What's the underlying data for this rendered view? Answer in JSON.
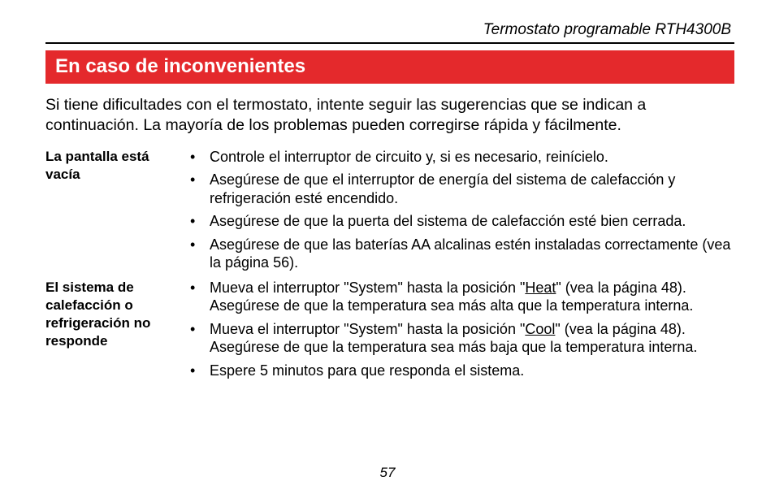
{
  "header": {
    "title": "Termostato programable RTH4300B"
  },
  "banner": {
    "title": "En caso de inconvenientes"
  },
  "intro": {
    "text": "Si tiene dificultades con el termostato, intente seguir las sugerencias que se indican a continuación. La mayoría de los problemas pueden corregirse rápida y fácilmente."
  },
  "sections": [
    {
      "label": "La pantalla está vacía",
      "items": [
        {
          "text": "Controle el interruptor de circuito y, si es necesario, reinícielo."
        },
        {
          "text": "Asegúrese de que el interruptor de energía del sistema de calefacción y refrigeración esté encendido."
        },
        {
          "text": "Asegúrese de que la puerta del sistema de calefacción esté bien cerrada."
        },
        {
          "text": "Asegúrese de que las baterías AA alcalinas estén instaladas correctamente (vea la página 56)."
        }
      ]
    },
    {
      "label": "El sistema de calefacción o refrigeración no responde",
      "items": [
        {
          "pre": "Mueva el interruptor \"System\" hasta la posición \"",
          "u": "Heat",
          "post": "\" (vea la página 48). Asegúrese de que la temperatura sea más alta que la temperatura interna."
        },
        {
          "pre": "Mueva el interruptor \"System\" hasta la posición \"",
          "u": "Cool",
          "post": "\" (vea la página 48). Asegúrese de que la temperatura sea más baja que la temperatura interna."
        },
        {
          "text": "Espere 5 minutos para que responda el sistema."
        }
      ]
    }
  ],
  "page": {
    "number": "57"
  }
}
